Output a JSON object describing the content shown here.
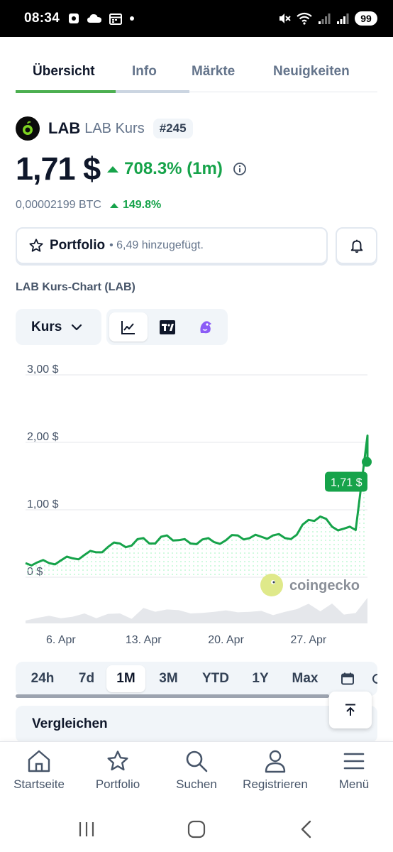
{
  "status_bar": {
    "time": "08:34",
    "battery": "99"
  },
  "tabs": [
    {
      "label": "Übersicht",
      "active": true
    },
    {
      "label": "Info",
      "active": false
    },
    {
      "label": "Märkte",
      "active": false
    },
    {
      "label": "Neuigkeiten",
      "active": false
    }
  ],
  "coin": {
    "symbol": "LAB",
    "name": "LAB Kurs",
    "rank": "#245",
    "price": "1,71 $",
    "change": "708.3% (1m)",
    "btc_price": "0,00002199 BTC",
    "btc_change": "149.8%"
  },
  "portfolio": {
    "label": "Portfolio",
    "sub": "• 6,49 hinzugefügt."
  },
  "chart_section": {
    "title": "LAB Kurs-Chart (LAB)",
    "select_label": "Kurs",
    "chart_types": [
      "line-chart-icon",
      "tradingview-icon",
      "gecko-icon"
    ]
  },
  "chart_data": {
    "type": "line",
    "title": "",
    "xlabel": "",
    "ylabel": "",
    "y_ticks": [
      "3,00 $",
      "2,00 $",
      "1,00 $",
      "0 $"
    ],
    "ylim": [
      0,
      3
    ],
    "x_ticks": [
      "6. Apr",
      "13. Apr",
      "20. Apr",
      "27. Apr"
    ],
    "x": [
      "Apr 3",
      "Apr 4",
      "Apr 5",
      "Apr 6",
      "Apr 7",
      "Apr 8",
      "Apr 9",
      "Apr 10",
      "Apr 11",
      "Apr 12",
      "Apr 13",
      "Apr 14",
      "Apr 15",
      "Apr 16",
      "Apr 17",
      "Apr 18",
      "Apr 19",
      "Apr 20",
      "Apr 21",
      "Apr 22",
      "Apr 23",
      "Apr 24",
      "Apr 25",
      "Apr 26",
      "Apr 27",
      "Apr 28",
      "Apr 29",
      "Apr 30",
      "May 1",
      "May 2"
    ],
    "series": [
      {
        "values": [
          0.21,
          0.22,
          0.21,
          0.25,
          0.28,
          0.33,
          0.37,
          0.45,
          0.5,
          0.47,
          0.58,
          0.5,
          0.62,
          0.55,
          0.5,
          0.56,
          0.52,
          0.55,
          0.62,
          0.58,
          0.6,
          0.62,
          0.58,
          0.63,
          0.85,
          0.9,
          0.75,
          0.72,
          0.7,
          2.1
        ]
      }
    ],
    "last_value_label": "1,71 $",
    "line_color": "#16a34a",
    "watermark": "coingecko",
    "grid": true
  },
  "ranges": [
    {
      "label": "24h",
      "active": false
    },
    {
      "label": "7d",
      "active": false
    },
    {
      "label": "1M",
      "active": true
    },
    {
      "label": "3M",
      "active": false
    },
    {
      "label": "YTD",
      "active": false
    },
    {
      "label": "1Y",
      "active": false
    },
    {
      "label": "Max",
      "active": false
    }
  ],
  "compare_label": "Vergleichen",
  "bottom_nav": [
    {
      "label": "Startseite",
      "icon": "home-icon"
    },
    {
      "label": "Portfolio",
      "icon": "star-icon"
    },
    {
      "label": "Suchen",
      "icon": "search-icon"
    },
    {
      "label": "Registrieren",
      "icon": "user-icon"
    },
    {
      "label": "Menü",
      "icon": "menu-icon"
    }
  ],
  "colors": {
    "accent_green": "#16a34a",
    "tab_green": "#4caf50"
  }
}
